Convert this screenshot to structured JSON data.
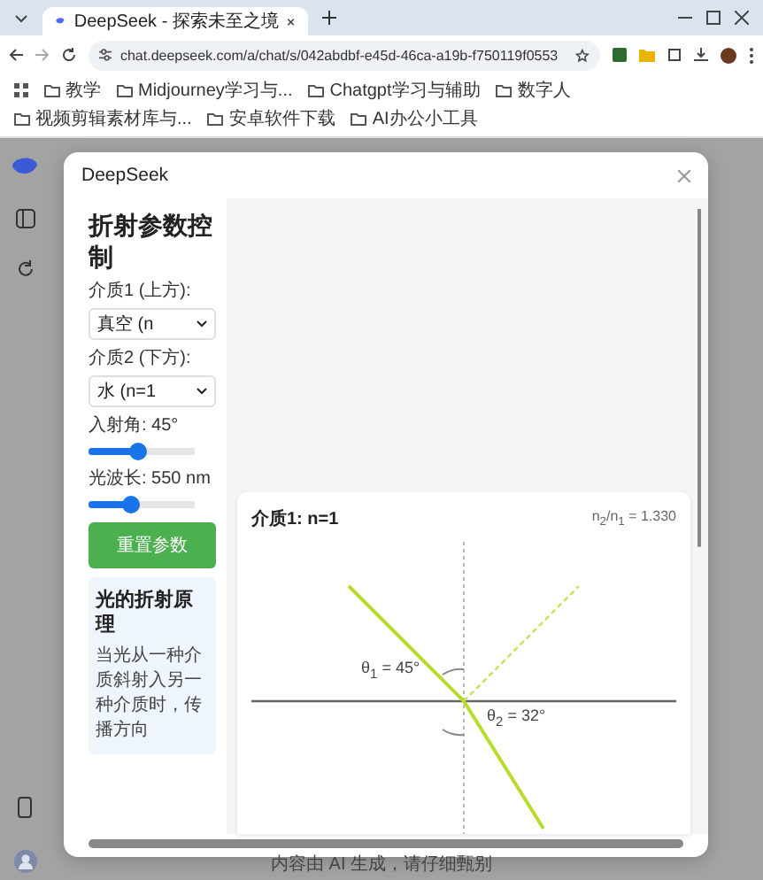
{
  "browser": {
    "tab_title": "DeepSeek - 探索未至之境",
    "url": "chat.deepseek.com/a/chat/s/042abdbf-e45d-46ca-a19b-f750119f0553",
    "bookmarks": [
      "教学",
      "Midjourney学习与...",
      "Chatgpt学习与辅助",
      "数字人",
      "视频剪辑素材库与...",
      "安卓软件下载",
      "AI办公小工具"
    ]
  },
  "modal": {
    "title": "DeepSeek",
    "controls": {
      "title": "折射参数控制",
      "fields": [
        {
          "kind": "select",
          "label": "介质1 (上方):",
          "value": "真空 (n"
        },
        {
          "kind": "select",
          "label": "介质2 (下方):",
          "value": "水 (n=1"
        },
        {
          "kind": "slider",
          "label": "入射角: 45°",
          "level": 0.47
        },
        {
          "kind": "slider",
          "label": "光波长: 550 nm",
          "level": 0.4
        }
      ],
      "button": "重置参数",
      "info": {
        "title": "光的折射原理",
        "text": "当光从一种介质斜射入另一种介质时，传播方向"
      }
    },
    "diagram": {
      "medium_label": "介质1: n=1",
      "ratio": "n$_{2}$/n$_{1}$ = 1.330",
      "incident_angle": "θ$_{1}$ = 45°",
      "refracted_angle": "θ$_{2}$ = 32°"
    }
  },
  "footer": "内容由 AI 生成，请仔细甄别"
}
